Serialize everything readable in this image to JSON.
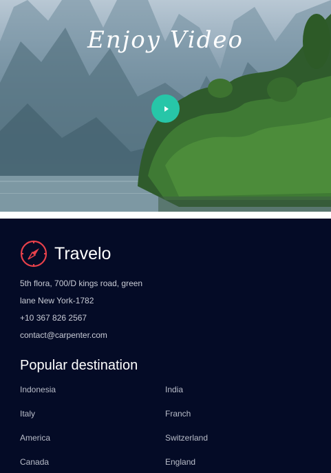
{
  "hero": {
    "title": "Enjoy Video",
    "accent_color": "#27c6a8",
    "play_icon": "play-icon"
  },
  "footer": {
    "brand": {
      "name": "Travelo",
      "icon": "compass-icon",
      "icon_color": "#e8414b"
    },
    "address_line1": "5th flora, 700/D kings road, green",
    "address_line2": "lane New York-1782",
    "phone": "+10 367 826 2567",
    "email": "contact@carpenter.com",
    "popular": {
      "title": "Popular destination",
      "destinations": [
        "Indonesia",
        "India",
        "Italy",
        "Franch",
        "America",
        "Switzerland",
        "Canada",
        "England"
      ]
    },
    "background_color": "#040b26"
  }
}
